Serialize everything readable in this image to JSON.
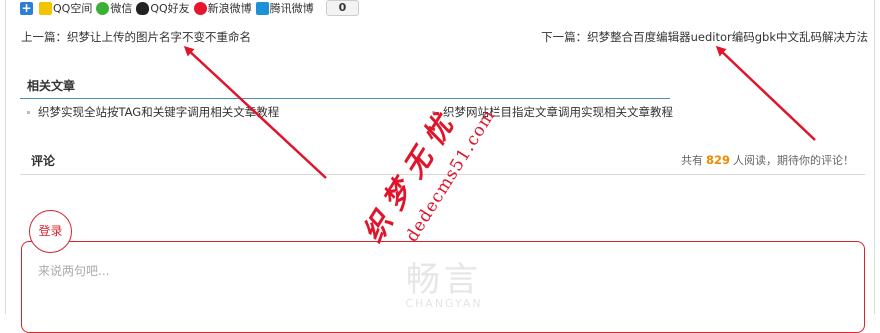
{
  "share": {
    "items": [
      {
        "label": "QQ空间",
        "icon": "qzone-icon"
      },
      {
        "label": "微信",
        "icon": "wechat-icon"
      },
      {
        "label": "QQ好友",
        "icon": "qq-icon"
      },
      {
        "label": "新浪微博",
        "icon": "weibo-icon"
      },
      {
        "label": "腾讯微博",
        "icon": "tencent-weibo-icon"
      }
    ],
    "count": "0"
  },
  "nav": {
    "prev": "上一篇：织梦让上传的图片名字不变不重命名",
    "next": "下一篇：织梦整合百度编辑器ueditor编码gbk中文乱码解决方法"
  },
  "related": {
    "title": "相关文章",
    "items": [
      "织梦实现全站按TAG和关键字调用相关文章教程",
      "织梦网站栏目指定文章调用实现相关文章教程"
    ]
  },
  "comments": {
    "title": "评论",
    "count_prefix": "共有",
    "count": "829",
    "count_suffix": "人阅读，期待你的评论！",
    "login": "登录",
    "placeholder": "来说两句吧...",
    "logo_zh": "畅言",
    "logo_en": "CHANGYAN"
  },
  "watermark": {
    "cn": "织梦无忧",
    "en": "dedecms51.com",
    "color": "#e0142a"
  }
}
